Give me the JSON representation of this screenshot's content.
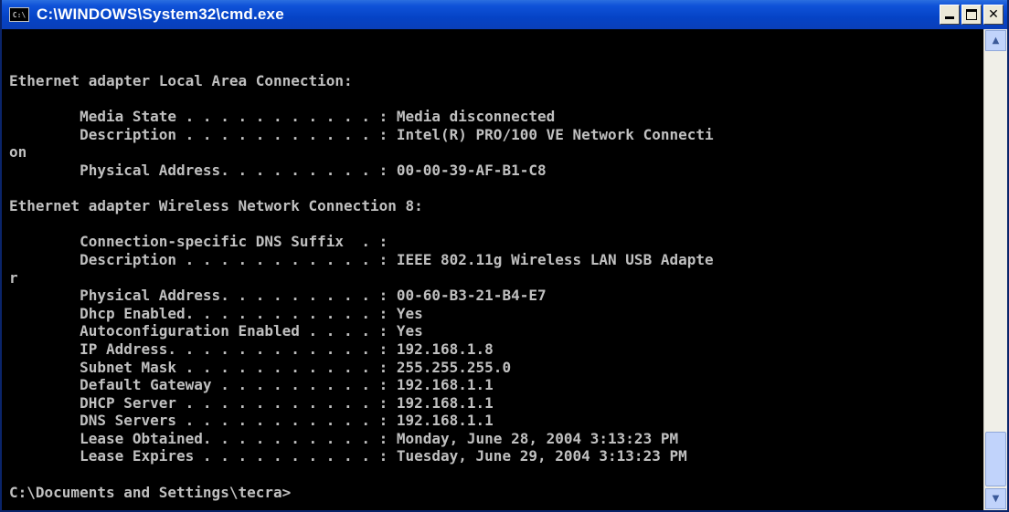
{
  "window": {
    "title": "C:\\WINDOWS\\System32\\cmd.exe",
    "icon_label": "C:\\"
  },
  "console": {
    "lines": [
      "Ethernet adapter Local Area Connection:",
      "",
      "        Media State . . . . . . . . . . . : Media disconnected",
      "        Description . . . . . . . . . . . : Intel(R) PRO/100 VE Network Connecti",
      "on",
      "        Physical Address. . . . . . . . . : 00-00-39-AF-B1-C8",
      "",
      "Ethernet adapter Wireless Network Connection 8:",
      "",
      "        Connection-specific DNS Suffix  . :",
      "        Description . . . . . . . . . . . : IEEE 802.11g Wireless LAN USB Adapte",
      "r",
      "        Physical Address. . . . . . . . . : 00-60-B3-21-B4-E7",
      "        Dhcp Enabled. . . . . . . . . . . : Yes",
      "        Autoconfiguration Enabled . . . . : Yes",
      "        IP Address. . . . . . . . . . . . : 192.168.1.8",
      "        Subnet Mask . . . . . . . . . . . : 255.255.255.0",
      "        Default Gateway . . . . . . . . . : 192.168.1.1",
      "        DHCP Server . . . . . . . . . . . : 192.168.1.1",
      "        DNS Servers . . . . . . . . . . . : 192.168.1.1",
      "        Lease Obtained. . . . . . . . . . : Monday, June 28, 2004 3:13:23 PM",
      "        Lease Expires . . . . . . . . . . : Tuesday, June 29, 2004 3:13:23 PM",
      "",
      "C:\\Documents and Settings\\tecra>"
    ]
  },
  "icons": {
    "app": "cmd-icon",
    "minimize": "minimize-icon",
    "maximize": "maximize-icon",
    "close": "close-icon",
    "scroll_up": "scroll-up-arrow-icon",
    "scroll_down": "scroll-down-arrow-icon"
  },
  "glyphs": {
    "close": "✕",
    "up": "▲",
    "down": "▼"
  },
  "colors": {
    "titlebar": "#0543c6",
    "console_bg": "#000000",
    "console_text": "#c0c0c0"
  }
}
